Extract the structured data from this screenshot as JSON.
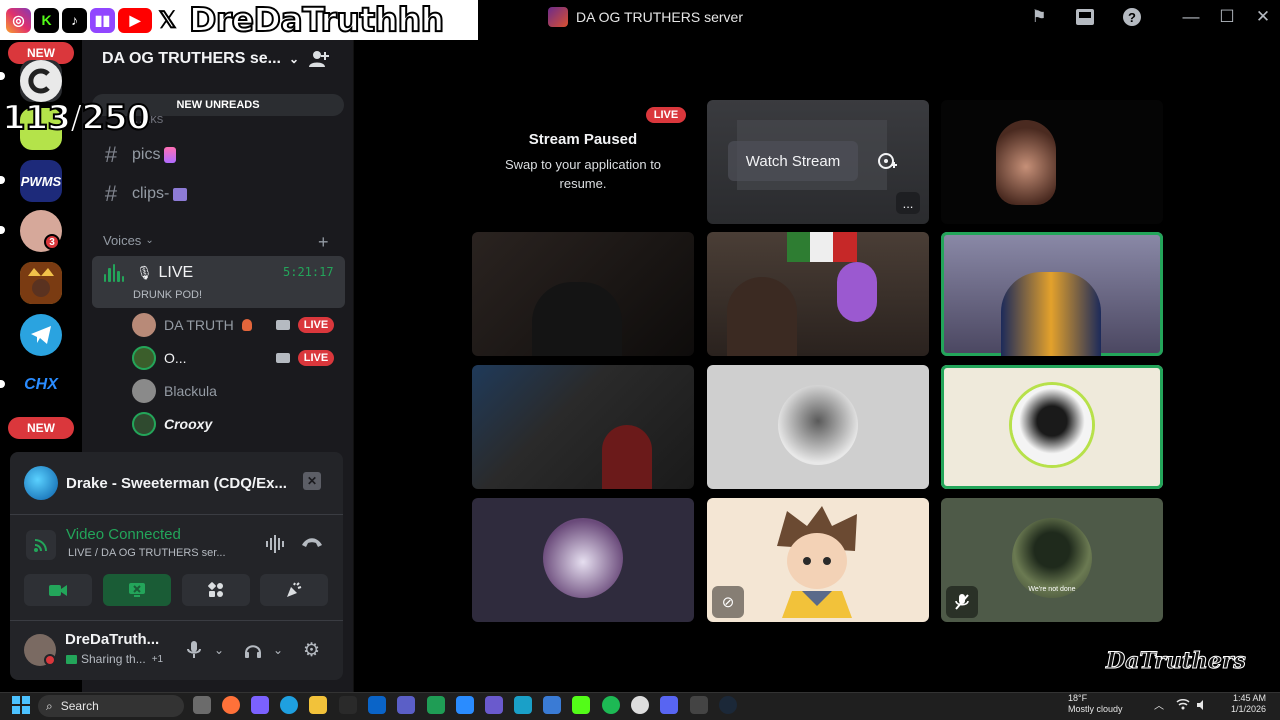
{
  "overlay": {
    "name": "DreDaTruthhh",
    "counter": "113/250",
    "socials": [
      "instagram-icon",
      "kick-icon",
      "tiktok-icon",
      "twitch-icon",
      "youtube-icon",
      "x-icon"
    ]
  },
  "window": {
    "server_title": "DA OG TRUTHERS server"
  },
  "rail": {
    "new_top": "NEW",
    "new_bottom": "NEW",
    "server_pwm": "PWMS",
    "server_chx": "CHX",
    "badge_count": "3"
  },
  "sidebar": {
    "guild_name": "DA OG TRUTHERS se...",
    "new_unreads": "NEW UNREADS",
    "partial_channel": "…nks",
    "channels": [
      {
        "name": "pics"
      },
      {
        "name": "clips-"
      }
    ],
    "category": "Voices",
    "voice_channel": {
      "name": "LIVE",
      "timer": "5:21:17",
      "status": "DRUNK POD!"
    },
    "members": [
      {
        "name": "DA TRUTH",
        "live": "LIVE"
      },
      {
        "name": "O...",
        "live": "LIVE"
      },
      {
        "name": "Blackula"
      },
      {
        "name": "Crooxy"
      }
    ]
  },
  "rtc": {
    "activity_title": "Drake - Sweeterman (CDQ/Ex...",
    "connection_title": "Video Connected",
    "connection_sub": "LIVE / DA OG TRUTHERS ser...",
    "user_name": "DreDaTruth...",
    "user_status": "Sharing th...",
    "user_status_extra": "+1"
  },
  "stage": {
    "paused_title": "Stream Paused",
    "paused_sub": "Swap to your application to resume.",
    "live_badge": "LIVE",
    "watch_label": "Watch Stream",
    "more_label": "...",
    "halo_caption": "We're not done"
  },
  "watermark": "DaTruthers",
  "taskbar": {
    "search": "Search",
    "weather_temp": "18°F",
    "weather_desc": "Mostly cloudy",
    "time": "1:45 AM",
    "date": "1/1/2026"
  },
  "colors": {
    "live_red": "#da373c",
    "connected_green": "#23a55a",
    "blurple": "#5865f2"
  }
}
